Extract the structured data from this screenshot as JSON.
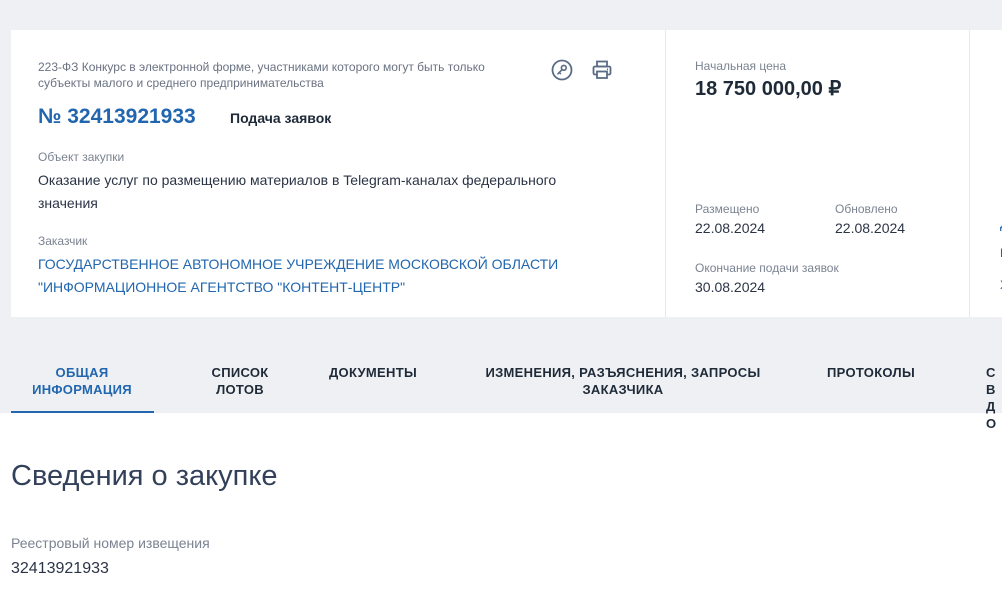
{
  "header": {
    "type": "223-ФЗ Конкурс в электронной форме, участниками которого могут быть только субъекты малого и среднего предпринимательства",
    "number": "№ 32413921933",
    "stage": "Подача заявок",
    "object_label": "Объект закупки",
    "object": "Оказание услуг по размещению материалов в Telegram-каналах федерального значения",
    "customer_label": "Заказчик",
    "customer": "ГОСУДАРСТВЕННОЕ АВТОНОМНОЕ УЧРЕЖДЕНИЕ МОСКОВСКОЙ ОБЛАСТИ \"ИНФОРМАЦИОННОЕ АГЕНТСТВО \"КОНТЕНТ-ЦЕНТР\"",
    "icons": [
      "key-icon",
      "print-icon"
    ]
  },
  "summary": {
    "price_label": "Начальная цена",
    "price": "18 750 000,00 ₽",
    "posted_label": "Размещено",
    "posted": "22.08.2024",
    "updated_label": "Обновлено",
    "updated": "22.08.2024",
    "deadline_label": "Окончание подачи заявок",
    "deadline": "30.08.2024"
  },
  "partial_column": {
    "glyphs": [
      "Д",
      "П",
      "Х"
    ]
  },
  "tabs": [
    {
      "label": "ОБЩАЯ ИНФОРМАЦИЯ",
      "active": true
    },
    {
      "label": "СПИСОК ЛОТОВ",
      "active": false
    },
    {
      "label": "ДОКУМЕНТЫ",
      "active": false
    },
    {
      "label": "ИЗМЕНЕНИЯ, РАЗЪЯСНЕНИЯ, ЗАПРОСЫ ЗАКАЗЧИКА",
      "active": false
    },
    {
      "label": "ПРОТОКОЛЫ",
      "active": false
    },
    {
      "label": "СВ ДО",
      "active": false
    }
  ],
  "main": {
    "title": "Сведения о закупке",
    "fields": [
      {
        "label": "Реестровый номер извещения",
        "value": "32413921933"
      }
    ]
  },
  "colors": {
    "accent": "#2166ae",
    "background": "#eef0f3",
    "text": "#1f2a38"
  }
}
